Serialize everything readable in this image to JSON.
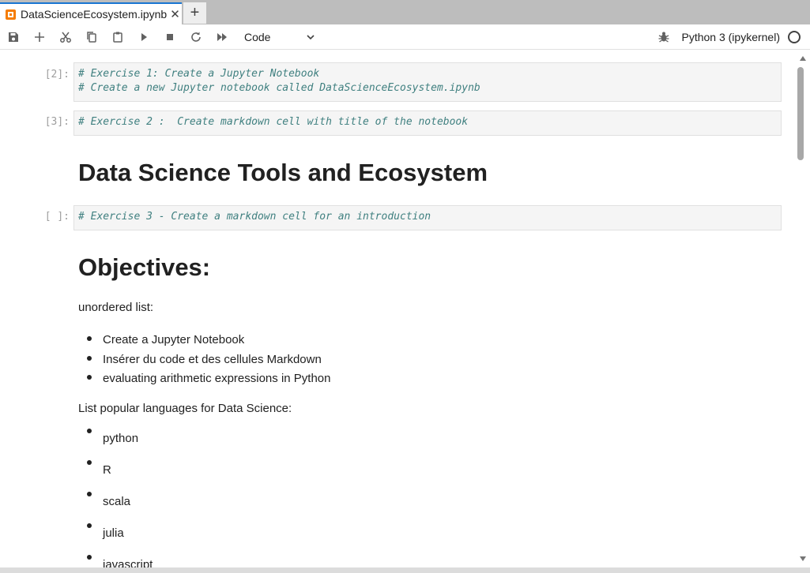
{
  "tab": {
    "title": "DataScienceEcosystem.ipynb",
    "close": "✕",
    "new_tab": "+"
  },
  "toolbar": {
    "cell_type": "Code",
    "kernel_name": "Python 3 (ipykernel)",
    "icons": [
      "save-icon",
      "add-cell-icon",
      "cut-icon",
      "copy-icon",
      "paste-icon",
      "run-icon",
      "stop-icon",
      "restart-icon",
      "fast-forward-icon",
      "debugger-icon",
      "kernel-status-icon"
    ]
  },
  "cells": {
    "c1": {
      "prompt": "[2]:",
      "lines": [
        "# Exercise 1: Create a Jupyter Notebook",
        "# Create a new Jupyter notebook called DataScienceEcosystem.ipynb"
      ]
    },
    "c2": {
      "prompt": "[3]:",
      "lines": [
        "# Exercise 2 :  Create markdown cell with title of the notebook"
      ]
    },
    "m1": {
      "heading": "Data Science Tools and Ecosystem"
    },
    "c3": {
      "prompt": "[ ]:",
      "lines": [
        "# Exercise 3 - Create a markdown cell for an introduction"
      ]
    },
    "m2": {
      "heading": "Objectives:",
      "para1": "unordered list:",
      "list1": [
        "Create a Jupyter Notebook",
        "Insérer du code et des cellules Markdown",
        "evaluating arithmetic expressions in Python"
      ],
      "para2": "List popular languages for Data Science:",
      "list2": [
        "python",
        "R",
        "scala",
        "julia",
        "javascript"
      ]
    }
  },
  "colors": {
    "accent": "#1976d2",
    "code_comment": "#408080",
    "tab_icon": "#f57c00"
  }
}
